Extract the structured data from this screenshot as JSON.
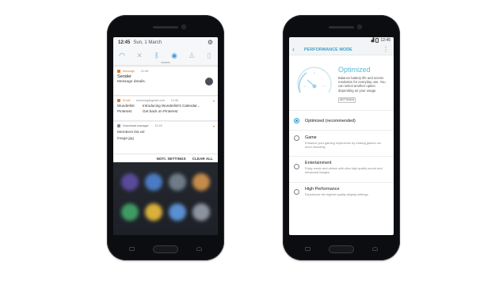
{
  "left_phone": {
    "status": {
      "time": "12:45",
      "date": "Sun, 1 March"
    },
    "quick_settings": [
      {
        "icon": "wifi-icon",
        "glyph": "◠",
        "active": true
      },
      {
        "icon": "mute-icon",
        "glyph": "✕",
        "active": false
      },
      {
        "icon": "bluetooth-icon",
        "glyph": "ᛒ",
        "active": true
      },
      {
        "icon": "nfc-icon",
        "glyph": "◉",
        "active": true
      },
      {
        "icon": "torch-icon",
        "glyph": "♙",
        "active": false
      },
      {
        "icon": "battery-saver-icon",
        "glyph": "▯",
        "active": false
      }
    ],
    "notifications": {
      "message": {
        "app": "Message",
        "time": "12:45",
        "title": "Sender",
        "body": "Message details."
      },
      "email": {
        "app": "Email",
        "account": "samsung@gmail.com",
        "time": "12:45",
        "rows": [
          {
            "from": "Wunderlist",
            "subject": "Introducing Wunderlist's Calendar..."
          },
          {
            "from": "Pinterest",
            "subject": "Get back on Pinterest"
          }
        ]
      },
      "download": {
        "app": "Download manager",
        "time": "12:45",
        "items": [
          "Members list.xsl",
          "image.jpg"
        ]
      }
    },
    "actions": {
      "noti_settings": "NOTI. SETTINGS",
      "clear_all": "CLEAR ALL"
    }
  },
  "right_phone": {
    "status": {
      "time": "12:45"
    },
    "app_bar": {
      "title": "PERFORMANCE MODE"
    },
    "hero": {
      "title": "Optimized",
      "description": "Balance battery life and screen resolution for everyday use. You can select another option depending on your usage.",
      "settings_button": "SETTINGS"
    },
    "options": [
      {
        "title": "Optimized (recommended)",
        "description": "",
        "selected": true
      },
      {
        "title": "Game",
        "description": "Enhance your gaming experience by making games run more smoothly.",
        "selected": false
      },
      {
        "title": "Entertainment",
        "description": "Enjoy music and videos with ultra high quality sound and enhanced images.",
        "selected": false
      },
      {
        "title": "High Performance",
        "description": "Experience the highest quality display settings.",
        "selected": false
      }
    ]
  },
  "colors": {
    "accent": "#2f9fd0",
    "notification_orange": "#e07a2a",
    "phone_body": "#0c0d10"
  }
}
